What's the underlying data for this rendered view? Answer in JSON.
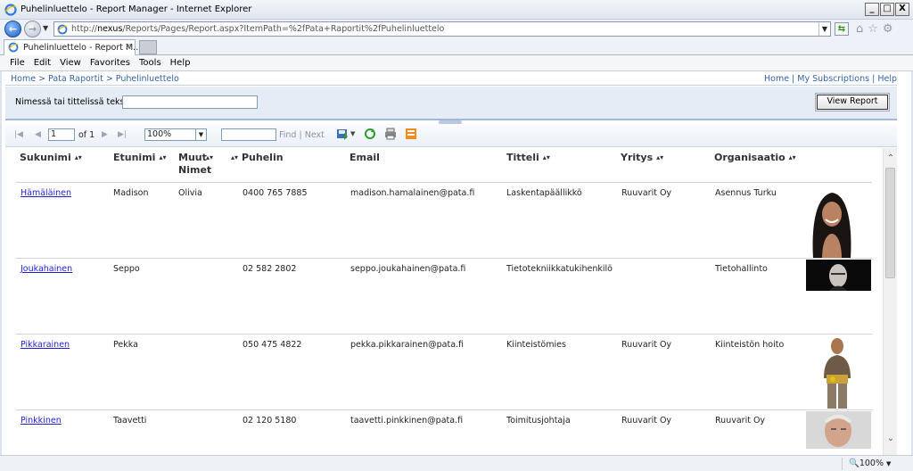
{
  "window": {
    "title": "Puhelinluettelo - Report Manager - Internet Explorer",
    "buttons": [
      "_",
      "□",
      "X"
    ]
  },
  "address": {
    "url_prefix": "http://",
    "url_host": "nexus",
    "url_path": "/Reports/Pages/Report.aspx?ItemPath=%2fPata+Raportit%2fPuhelinluettelo"
  },
  "tab": {
    "title": "Puhelinluettelo - Report M...",
    "close": "×"
  },
  "menu": [
    "File",
    "Edit",
    "View",
    "Favorites",
    "Tools",
    "Help"
  ],
  "breadcrumb": {
    "path": "Home > Pata Raportit > Puhelinluettelo",
    "links": "Home | My Subscriptions | Help"
  },
  "params": {
    "label": "Nimessä tai tittelissä teksti",
    "value": "",
    "view_button": "View Report"
  },
  "toolbar": {
    "page": "1",
    "of_pages": "of 1",
    "zoom": "100%",
    "find_label": "Find",
    "separator": "|",
    "next_label": "Next"
  },
  "columns": [
    {
      "label": "Sukunimi",
      "sort": "▴▾"
    },
    {
      "label": "Etunimi",
      "sort": "▴▾"
    },
    {
      "label": "Muut Nimet",
      "sort": "▴▾"
    },
    {
      "label": "Puhelin",
      "sort": "▴▾"
    },
    {
      "label": "Email",
      "sort": ""
    },
    {
      "label": "Titteli",
      "sort": "▴▾"
    },
    {
      "label": "Yritys",
      "sort": "▴▾"
    },
    {
      "label": "Organisaatio",
      "sort": "▴▾"
    }
  ],
  "rows": [
    {
      "sukunimi": "Hämäläinen",
      "etunimi": "Madison",
      "muut": "Olivia",
      "puhelin": "0400 765 7885",
      "email": "madison.hamalainen@pata.fi",
      "titteli": "Laskentapäällikkö",
      "yritys": "Ruuvarit Oy",
      "org": "Asennus Turku"
    },
    {
      "sukunimi": "Joukahainen",
      "etunimi": "Seppo",
      "muut": "",
      "puhelin": "02 582 2802",
      "email": "seppo.joukahainen@pata.fi",
      "titteli": "Tietotekniikkatukihenkilö",
      "yritys": "",
      "org": "Tietohallinto"
    },
    {
      "sukunimi": "Pikkarainen",
      "etunimi": "Pekka",
      "muut": "",
      "puhelin": "050 475 4822",
      "email": "pekka.pikkarainen@pata.fi",
      "titteli": "Kiinteistömies",
      "yritys": "Ruuvarit Oy",
      "org": "Kiinteistön hoito"
    },
    {
      "sukunimi": "Pinkkinen",
      "etunimi": "Taavetti",
      "muut": "",
      "puhelin": "02 120 5180",
      "email": "taavetti.pinkkinen@pata.fi",
      "titteli": "Toimitusjohtaja",
      "yritys": "Ruuvarit Oy",
      "org": "Ruuvarit Oy"
    }
  ],
  "status": {
    "zoom": "100%"
  },
  "colors": {
    "link": "#1f1fd6",
    "breadcrumb": "#3463a8",
    "param_bg": "#e5ecf6"
  }
}
